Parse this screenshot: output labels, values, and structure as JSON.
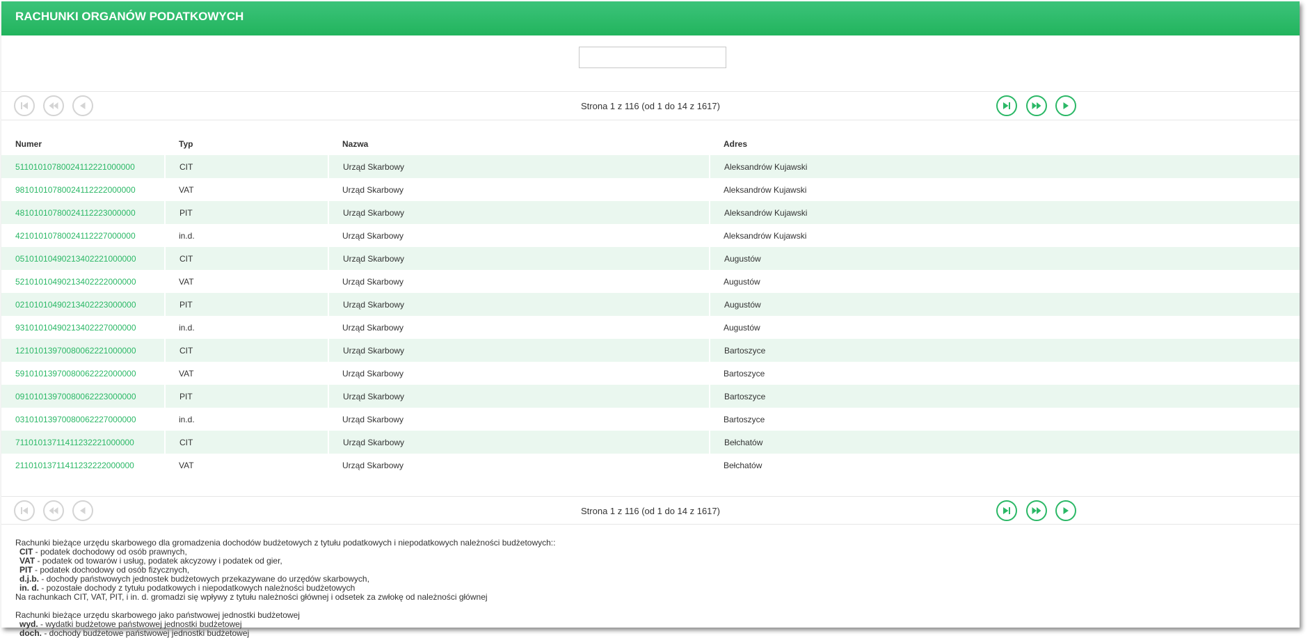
{
  "header": {
    "title": "RACHUNKI ORGANÓW PODATKOWYCH"
  },
  "search": {
    "value": "",
    "placeholder": ""
  },
  "pager": {
    "info": "Strona 1 z 116 (od 1 do 14 z 1617)"
  },
  "icons": {
    "first": "skip-first-icon",
    "prev_fast": "fast-rewind-icon",
    "prev": "previous-icon",
    "last": "skip-last-icon",
    "next_fast": "fast-forward-icon",
    "next": "next-icon"
  },
  "colors": {
    "accent": "#2bb866",
    "row_stripe": "#eaf7ef",
    "disabled": "#d4d4d4"
  },
  "table": {
    "columns": [
      "Numer",
      "Typ",
      "Nazwa",
      "Adres"
    ],
    "rows": [
      [
        "51101010780024112221000000",
        "CIT",
        "Urząd Skarbowy",
        "Aleksandrów Kujawski"
      ],
      [
        "98101010780024112222000000",
        "VAT",
        "Urząd Skarbowy",
        "Aleksandrów Kujawski"
      ],
      [
        "48101010780024112223000000",
        "PIT",
        "Urząd Skarbowy",
        "Aleksandrów Kujawski"
      ],
      [
        "42101010780024112227000000",
        "in.d.",
        "Urząd Skarbowy",
        "Aleksandrów Kujawski"
      ],
      [
        "05101010490213402221000000",
        "CIT",
        "Urząd Skarbowy",
        "Augustów"
      ],
      [
        "52101010490213402222000000",
        "VAT",
        "Urząd Skarbowy",
        "Augustów"
      ],
      [
        "02101010490213402223000000",
        "PIT",
        "Urząd Skarbowy",
        "Augustów"
      ],
      [
        "93101010490213402227000000",
        "in.d.",
        "Urząd Skarbowy",
        "Augustów"
      ],
      [
        "12101013970080062221000000",
        "CIT",
        "Urząd Skarbowy",
        "Bartoszyce"
      ],
      [
        "59101013970080062222000000",
        "VAT",
        "Urząd Skarbowy",
        "Bartoszyce"
      ],
      [
        "09101013970080062223000000",
        "PIT",
        "Urząd Skarbowy",
        "Bartoszyce"
      ],
      [
        "03101013970080062227000000",
        "in.d.",
        "Urząd Skarbowy",
        "Bartoszyce"
      ],
      [
        "71101013711411232221000000",
        "CIT",
        "Urząd Skarbowy",
        "Bełchatów"
      ],
      [
        "21101013711411232222000000",
        "VAT",
        "Urząd Skarbowy",
        "Bełchatów"
      ]
    ]
  },
  "footer": {
    "intro1": "Rachunki bieżące urzędu skarbowego dla gromadzenia dochodów budżetowych z tytułu podatkowych i niepodatkowych należności budżetowych::",
    "items1": [
      {
        "code": "CIT",
        "text": " - podatek dochodowy od osób prawnych,"
      },
      {
        "code": "VAT",
        "text": " - podatek od towarów i usług, podatek akcyzowy i podatek od gier,"
      },
      {
        "code": "PIT",
        "text": " - podatek dochodowy od osób fizycznych,"
      },
      {
        "code": "d.j.b.",
        "text": " - dochody państwowych jednostek budżetowych przekazywane do urzędów skarbowych,"
      },
      {
        "code": "in. d.",
        "text": " - pozostałe dochody z tytułu podatkowych i niepodatkowych należności budżetowych"
      }
    ],
    "note": "Na rachunkach CIT, VAT, PIT, i in. d. gromadzi się wpływy z tytułu należności głównej i odsetek za zwłokę od należności głównej",
    "intro2": "Rachunki bieżące urzędu skarbowego jako państwowej jednostki budżetowej",
    "items2": [
      {
        "code": "wyd.",
        "text": " - wydatki budżetowe państwowej jednostki budżetowej"
      },
      {
        "code": "doch.",
        "text": " - dochody budżetowe państwowej jednostki budżetowej"
      }
    ]
  }
}
